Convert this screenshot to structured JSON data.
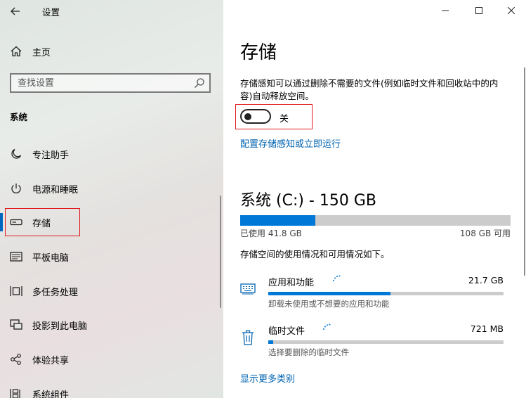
{
  "app": {
    "title": "设置"
  },
  "sidebar": {
    "home_label": "主页",
    "search_placeholder": "查找设置",
    "section": "系统",
    "items": [
      {
        "label": "专注助手",
        "icon": "moon-icon"
      },
      {
        "label": "电源和睡眠",
        "icon": "power-icon"
      },
      {
        "label": "存储",
        "icon": "storage-drive-icon",
        "selected": true
      },
      {
        "label": "平板电脑",
        "icon": "tablet-icon"
      },
      {
        "label": "多任务处理",
        "icon": "multitasking-icon"
      },
      {
        "label": "投影到此电脑",
        "icon": "project-icon"
      },
      {
        "label": "体验共享",
        "icon": "shared-experiences-icon"
      },
      {
        "label": "系统组件",
        "icon": "components-icon"
      }
    ]
  },
  "main": {
    "title": "存储",
    "storage_sense_desc": "存储感知可以通过删除不需要的文件(例如临时文件和回收站中的内容)自动释放空间。",
    "toggle_state_label": "关",
    "toggle_on": false,
    "configure_link": "配置存储感知或立即运行",
    "drive_title": "系统 (C:) - 150 GB",
    "used_label": "已使用 41.8 GB",
    "free_label": "108 GB 可用",
    "used_fraction": 0.279,
    "usage_desc": "存储空间的使用情况和可用情况如下。",
    "categories": [
      {
        "name": "应用和功能",
        "size": "21.7 GB",
        "desc": "卸载未使用或不想要的应用和功能",
        "fraction": 0.52,
        "icon": "keyboard-icon"
      },
      {
        "name": "临时文件",
        "size": "721 MB",
        "desc": "选择要删除的临时文件",
        "fraction": 0.02,
        "icon": "trash-icon"
      }
    ],
    "more_link": "显示更多类别"
  },
  "colors": {
    "accent": "#0078d7",
    "link": "#0063b1",
    "highlight_box": "#e0191f"
  }
}
